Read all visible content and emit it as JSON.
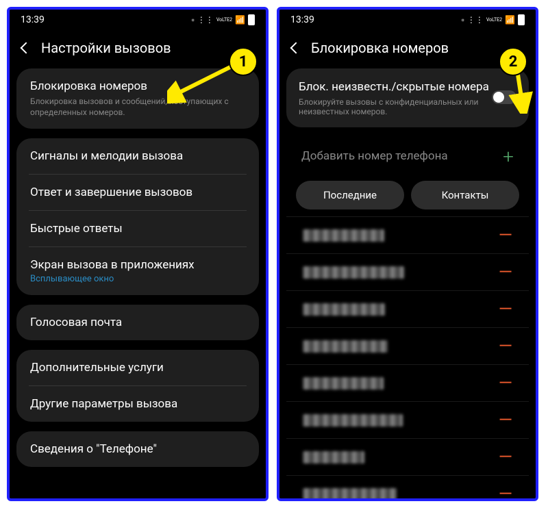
{
  "statusbar": {
    "time": "13:39",
    "lte_text": "VoLTE2"
  },
  "screen1": {
    "header": "Настройки вызовов",
    "callout": "1",
    "card1": {
      "title": "Блокировка номеров",
      "sub": "Блокировка вызовов и сообщений, поступающих с определенных номеров."
    },
    "card2": {
      "items": [
        {
          "title": "Сигналы и мелодии вызова"
        },
        {
          "title": "Ответ и завершение вызовов"
        },
        {
          "title": "Быстрые ответы"
        },
        {
          "title": "Экран вызова в приложениях",
          "sub2": "Всплывающее окно"
        }
      ]
    },
    "card3": {
      "title": "Голосовая почта"
    },
    "card4": {
      "items": [
        {
          "title": "Дополнительные услуги"
        },
        {
          "title": "Другие параметры вызова"
        }
      ]
    },
    "card5": {
      "title": "Сведения о \"Телефоне\""
    }
  },
  "screen2": {
    "header": "Блокировка номеров",
    "callout": "2",
    "toggle": {
      "title": "Блок. неизвестн./скрытые номера",
      "sub": "Блокируйте вызовы с конфиденциальных или неизвестных номеров."
    },
    "add_placeholder": "Добавить номер телефона",
    "tabs": [
      "Последние",
      "Контакты"
    ],
    "blocked_count": 8
  }
}
